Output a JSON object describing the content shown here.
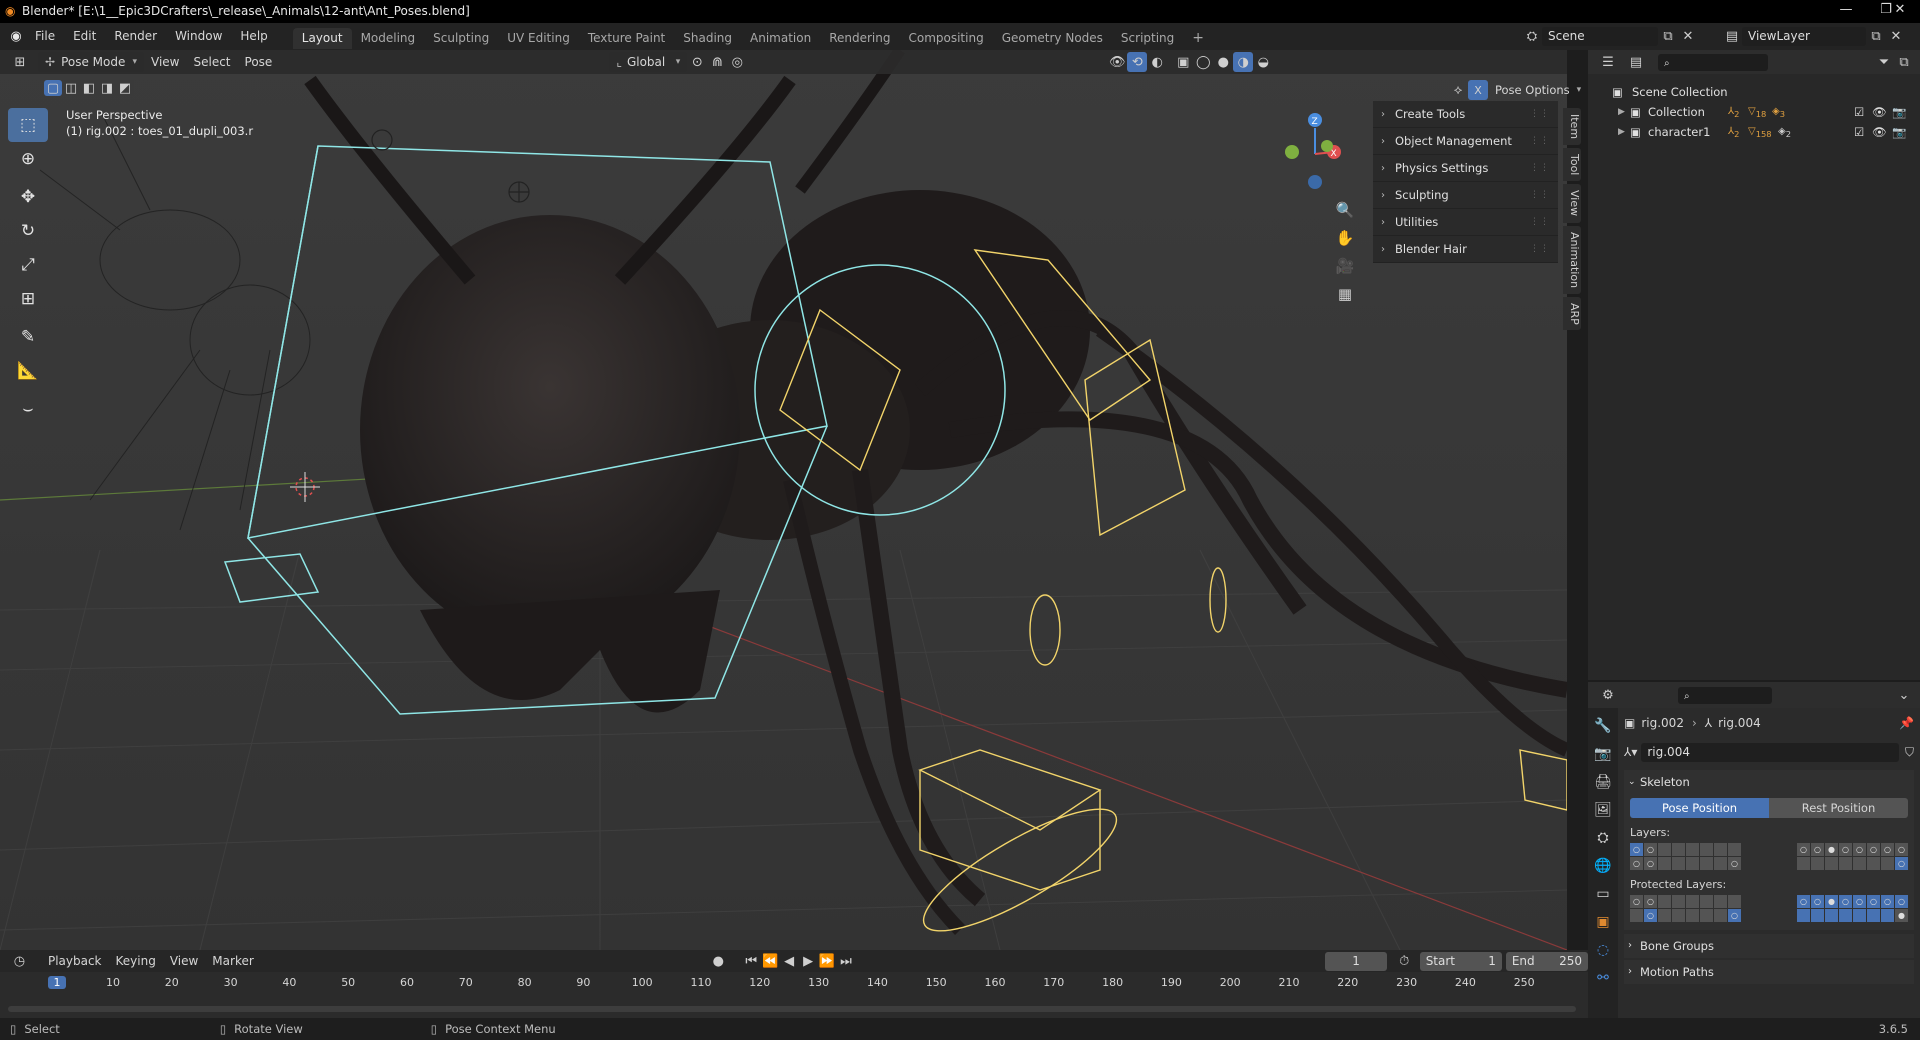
{
  "window": {
    "title": "Blender* [E:\\1__Epic3DCrafters\\_release\\_Animals\\12-ant\\Ant_Poses.blend]"
  },
  "menubar": {
    "menus": [
      "File",
      "Edit",
      "Render",
      "Window",
      "Help"
    ],
    "workspaces": [
      "Layout",
      "Modeling",
      "Sculpting",
      "UV Editing",
      "Texture Paint",
      "Shading",
      "Animation",
      "Rendering",
      "Compositing",
      "Geometry Nodes",
      "Scripting"
    ],
    "active_workspace": "Layout",
    "scene_label": "Scene",
    "view_layer_label": "ViewLayer"
  },
  "viewport_header": {
    "mode": "Pose Mode",
    "menus": [
      "View",
      "Select",
      "Pose"
    ],
    "orientation": "Global",
    "pose_options": "Pose Options"
  },
  "viewport": {
    "perspective": "User Perspective",
    "active_info": "(1) rig.002 : toes_01_dupli_003.r"
  },
  "npanel": {
    "items": [
      "Create Tools",
      "Object Management",
      "Physics Settings",
      "Sculpting",
      "Utilities",
      "Blender Hair"
    ],
    "tabs": [
      "Item",
      "Tool",
      "View",
      "Animation",
      "ARP"
    ]
  },
  "outliner": {
    "root": "Scene Collection",
    "rows": [
      {
        "name": "Collection",
        "badge1": "2",
        "badge2": "18",
        "badge3": "3"
      },
      {
        "name": "character1",
        "badge1": "2",
        "badge2": "158",
        "badge3": "2"
      }
    ]
  },
  "properties": {
    "breadcrumb_object": "rig.002",
    "breadcrumb_data": "rig.004",
    "datablock": "rig.004",
    "skeleton_label": "Skeleton",
    "pose_position": "Pose Position",
    "rest_position": "Rest Position",
    "layers_label": "Layers:",
    "protected_layers_label": "Protected Layers:",
    "bone_groups": "Bone Groups",
    "motion_paths": "Motion Paths"
  },
  "timeline": {
    "menus": [
      "Playback",
      "Keying",
      "View",
      "Marker"
    ],
    "current_frame": "1",
    "start_label": "Start",
    "start_value": "1",
    "end_label": "End",
    "end_value": "250",
    "ruler": [
      "1",
      "10",
      "20",
      "30",
      "40",
      "50",
      "60",
      "70",
      "80",
      "90",
      "100",
      "110",
      "120",
      "130",
      "140",
      "150",
      "160",
      "170",
      "180",
      "190",
      "200",
      "210",
      "220",
      "230",
      "240",
      "250"
    ]
  },
  "statusbar": {
    "select": "Select",
    "rotate": "Rotate View",
    "context": "Pose Context Menu",
    "version": "3.6.5"
  },
  "colors": {
    "accent": "#4772b3",
    "bone_select": "#f2d46a",
    "bone_active": "#8fe6e6"
  }
}
